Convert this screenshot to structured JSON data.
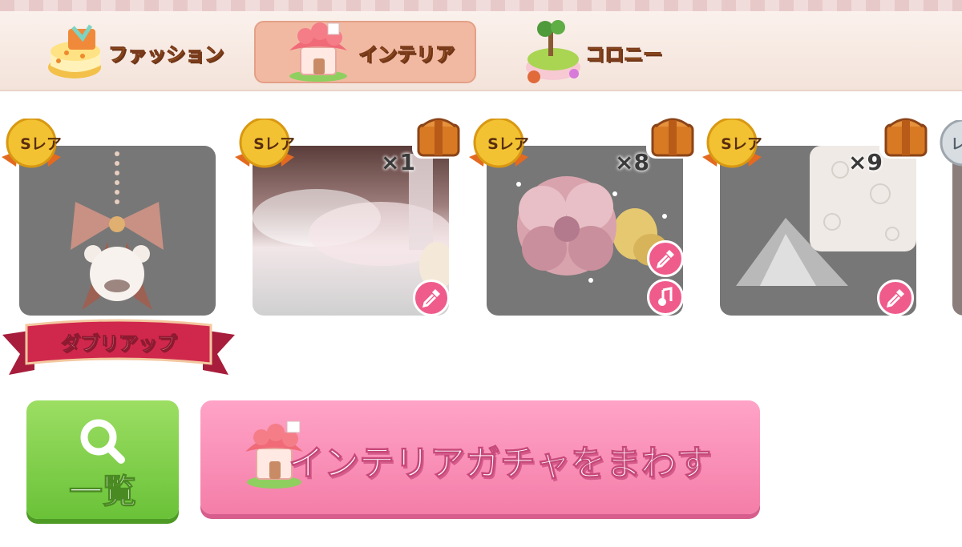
{
  "tabs": [
    {
      "id": "fashion",
      "label": "ファッション",
      "icon": "cake-gift-icon",
      "active": false
    },
    {
      "id": "interior",
      "label": "インテリア",
      "icon": "house-icon",
      "active": true
    },
    {
      "id": "colony",
      "label": "コロニー",
      "icon": "island-tree-icon",
      "active": false
    }
  ],
  "cards": [
    {
      "rarity": "Sレア",
      "count": null,
      "tag": "ダブリアップ",
      "art": "bear-bell-bow",
      "tools": []
    },
    {
      "rarity": "Sレア",
      "count": "×1",
      "art": "pink-cloud-room",
      "tools": [
        "dropper-icon"
      ]
    },
    {
      "rarity": "Sレア",
      "count": "×8",
      "art": "pink-flower",
      "tools": [
        "dropper-icon",
        "music-note-icon"
      ]
    },
    {
      "rarity": "Sレア",
      "count": "×9",
      "art": "lace-wall",
      "tools": [
        "dropper-icon"
      ]
    }
  ],
  "partial_card_badge": "レ",
  "buttons": {
    "list_label": "一覧",
    "gacha_label": "インテリアガチャをまわす"
  },
  "colors": {
    "tab_active_bg": "#f2b9a2",
    "card_bg": "#777777",
    "list_button": "#7dcc47",
    "gacha_button": "#f58db3",
    "tool_button": "#ef5c8c",
    "ribbon": "#d0284c"
  }
}
